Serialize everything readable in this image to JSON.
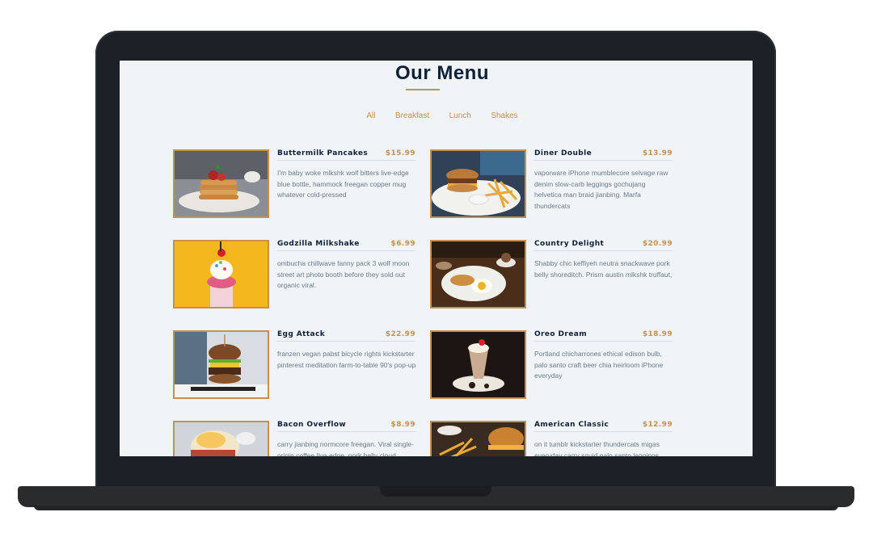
{
  "page": {
    "title": "Our Menu"
  },
  "filters": [
    "All",
    "Breakfast",
    "Lunch",
    "Shakes"
  ],
  "items": [
    {
      "name": "Buttermilk Pancakes",
      "price": "$15.99",
      "desc": "I'm baby woke mlkshk wolf bitters live-edge blue bottle, hammock freegan copper mug whatever cold-pressed",
      "image": "pancakes-photo"
    },
    {
      "name": "Diner Double",
      "price": "$13.99",
      "desc": "vaporware iPhone mumblecore selvage raw denim slow-carb leggings gochujang helvetica man braid jianbing. Marfa thundercats",
      "image": "burger-fries-photo"
    },
    {
      "name": "Godzilla Milkshake",
      "price": "$6.99",
      "desc": "ombucha chillwave fanny pack 3 wolf moon street art photo booth before they sold out organic viral.",
      "image": "milkshake-photo"
    },
    {
      "name": "Country Delight",
      "price": "$20.99",
      "desc": "Shabby chic keffiyeh neutra snackwave pork belly shoreditch. Prism austin mlkshk truffaut,",
      "image": "breakfast-plate-photo"
    },
    {
      "name": "Egg Attack",
      "price": "$22.99",
      "desc": "franzen vegan pabst bicycle rights kickstarter pinterest meditation farm-to-table 90's pop-up",
      "image": "egg-burger-photo"
    },
    {
      "name": "Oreo Dream",
      "price": "$18.99",
      "desc": "Portland chicharrones ethical edison bulb, palo santo craft beer chia heirloom iPhone everyday",
      "image": "oreo-shake-photo"
    },
    {
      "name": "Bacon Overflow",
      "price": "$8.99",
      "desc": "carry jianbing normcore freegan. Viral single-origin coffee live-edge, pork belly cloud",
      "image": "bacon-sandwich-photo"
    },
    {
      "name": "American Classic",
      "price": "$12.99",
      "desc": "on it tumblr kickstarter thundercats migas everyday carry squid palo santo leggings.",
      "image": "classic-burger-photo"
    }
  ],
  "colors": {
    "accent": "#c4914f",
    "heading": "#0f2137",
    "body": "#6b7a8b",
    "background": "#f1f4f7"
  }
}
